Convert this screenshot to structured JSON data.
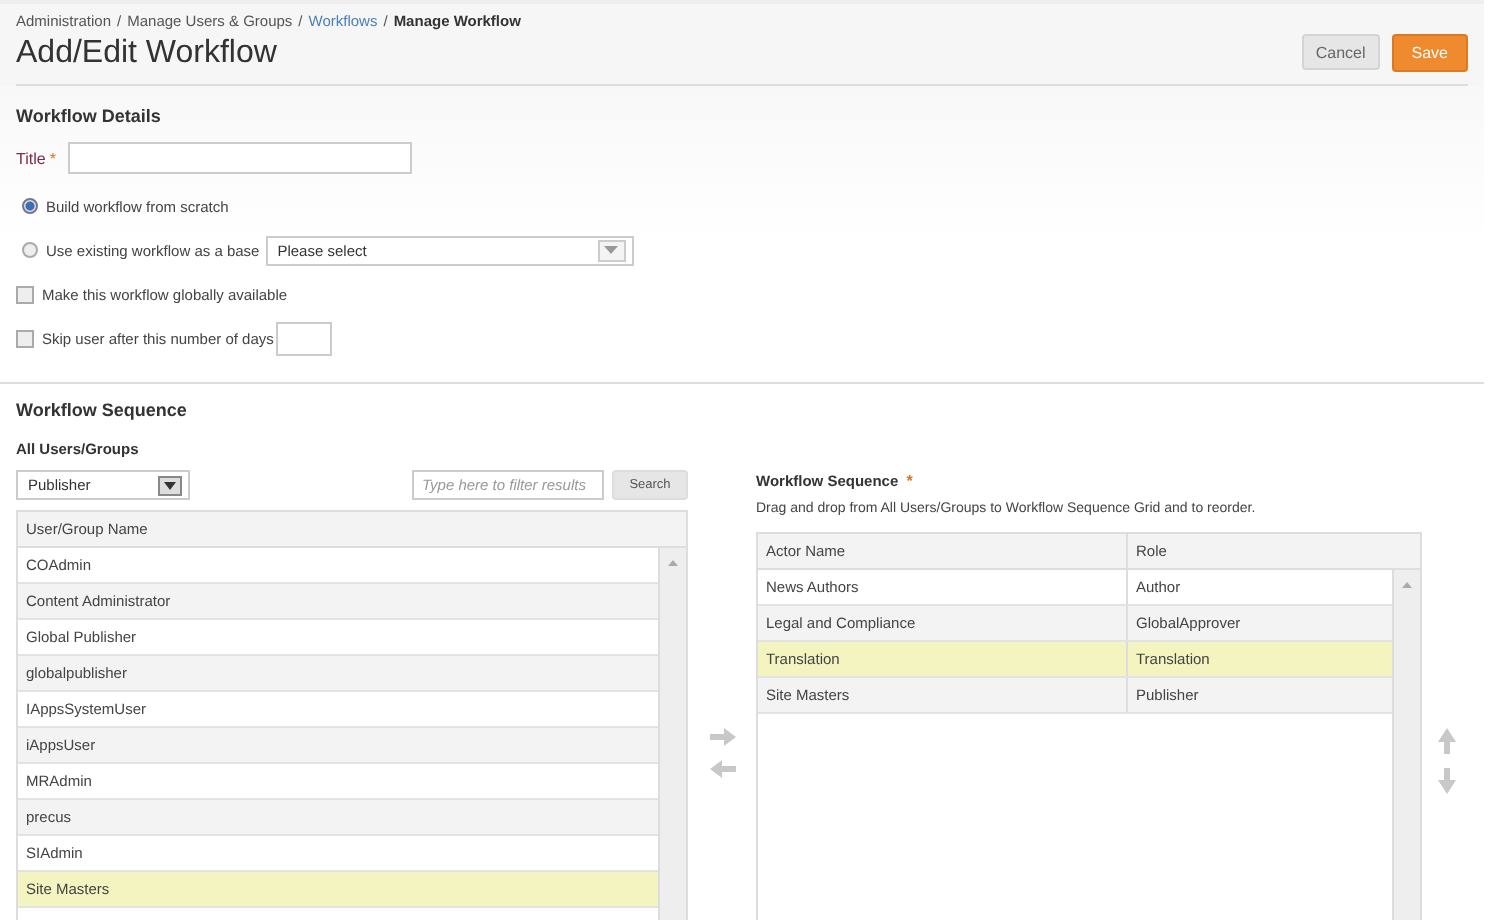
{
  "breadcrumb_separator": "/",
  "breadcrumb": [
    {
      "label": "Administration",
      "kind": "text"
    },
    {
      "label": "Manage Users & Groups",
      "kind": "text"
    },
    {
      "label": "Workflows",
      "kind": "link"
    },
    {
      "label": "Manage Workflow",
      "kind": "current"
    }
  ],
  "page_title": "Add/Edit Workflow",
  "buttons": [
    {
      "label": "Cancel",
      "kind": "secondary"
    },
    {
      "label": "Save",
      "kind": "primary"
    }
  ],
  "details": {
    "heading": "Workflow Details",
    "title_label": "Title",
    "required_mark": "*",
    "options": [
      {
        "label": "Build workflow from scratch",
        "selected": true
      },
      {
        "label": "Use existing workflow as a base",
        "selected": false,
        "select": "Please select"
      }
    ],
    "global_checkbox": {
      "label": "Make this workflow globally available",
      "checked": false
    },
    "skip_checkbox": {
      "label": "Skip user after this number of days",
      "checked": false
    }
  },
  "sequence": {
    "heading": "Workflow Sequence",
    "all_users": {
      "label": "All Users/Groups",
      "filter_select": "Publisher",
      "search_placeholder": "Type here to filter results",
      "search_button": "Search",
      "column": "User/Group Name",
      "rows": [
        {
          "name": "COAdmin",
          "selected": false
        },
        {
          "name": "Content Administrator",
          "selected": false
        },
        {
          "name": "Global Publisher",
          "selected": false
        },
        {
          "name": "globalpublisher",
          "selected": false
        },
        {
          "name": "IAppsSystemUser",
          "selected": false
        },
        {
          "name": "iAppsUser",
          "selected": false
        },
        {
          "name": "MRAdmin",
          "selected": false
        },
        {
          "name": "precus",
          "selected": false
        },
        {
          "name": "SIAdmin",
          "selected": false
        },
        {
          "name": "Site Masters",
          "selected": true
        }
      ]
    },
    "grid": {
      "label": "Workflow Sequence",
      "required_mark": "*",
      "description": "Drag and drop from All Users/Groups to Workflow Sequence Grid and to reorder.",
      "columns": [
        "Actor Name",
        "Role"
      ],
      "rows": [
        {
          "actor": "News Authors",
          "role": "Author",
          "selected": false
        },
        {
          "actor": "Legal and Compliance",
          "role": "GlobalApprover",
          "selected": false
        },
        {
          "actor": "Translation",
          "role": "Translation",
          "selected": true
        },
        {
          "actor": "Site Masters",
          "role": "Publisher",
          "selected": false
        }
      ]
    }
  }
}
